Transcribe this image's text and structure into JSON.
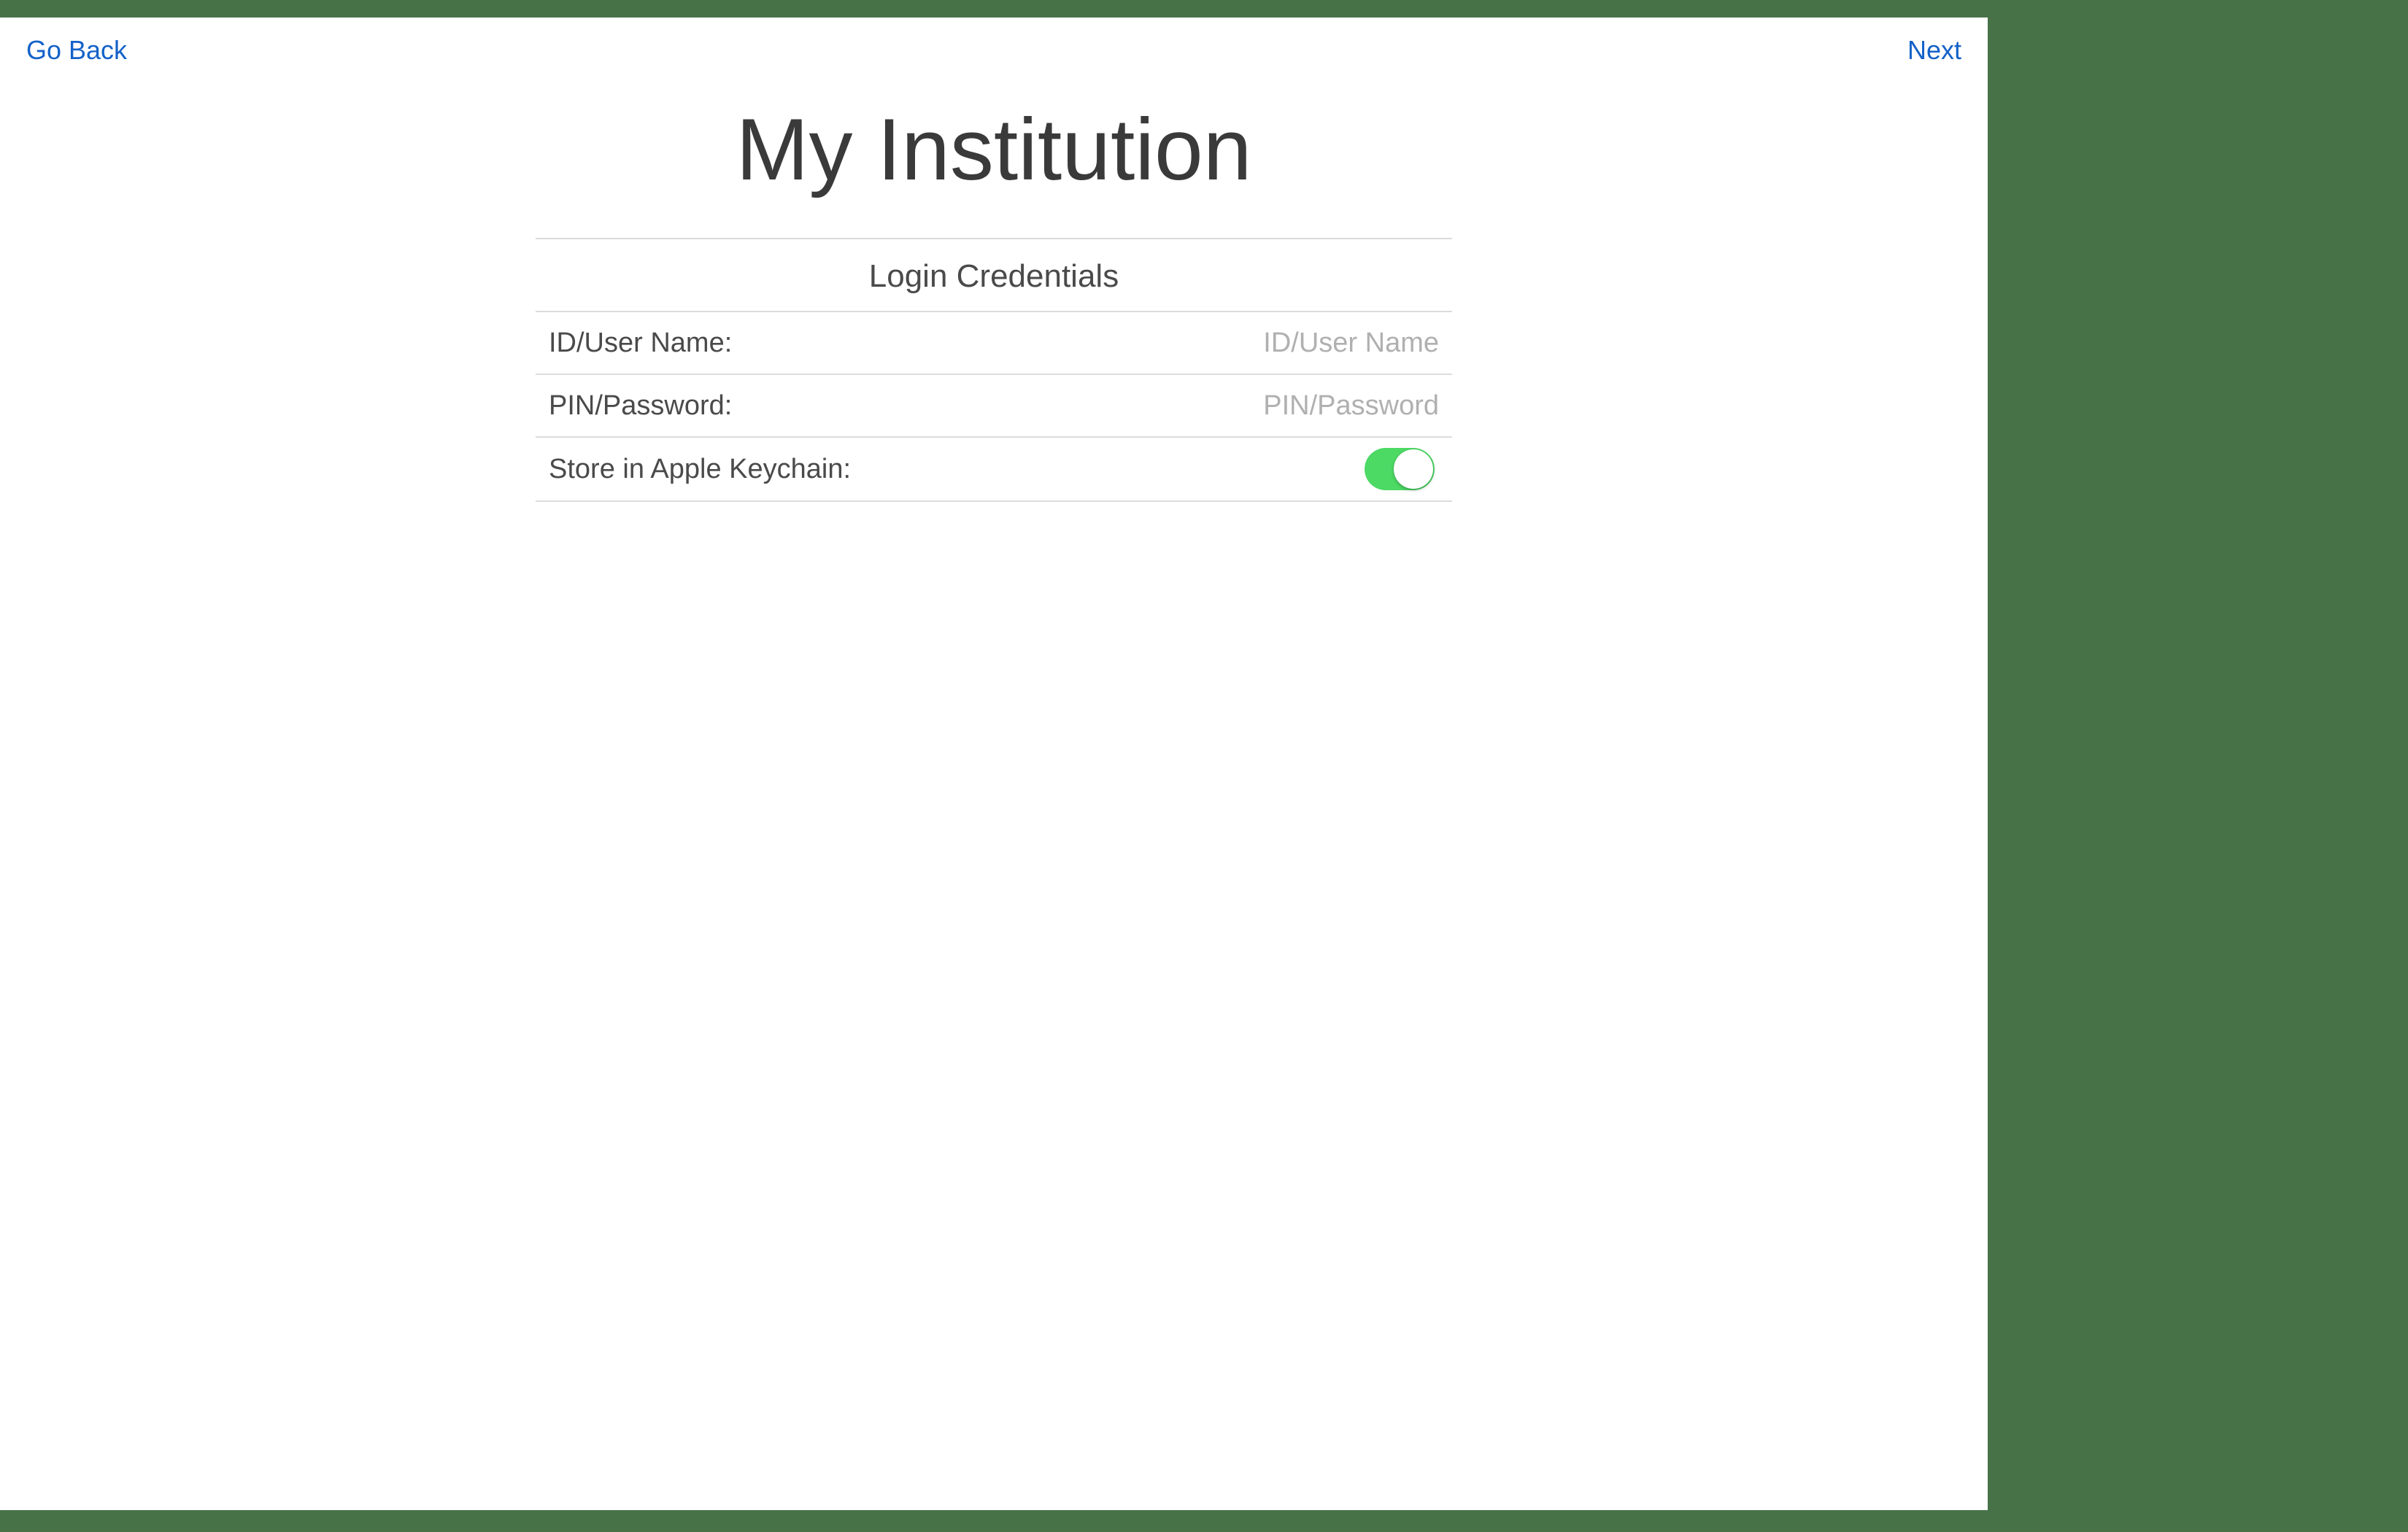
{
  "nav": {
    "back_label": "Go Back",
    "next_label": "Next"
  },
  "page": {
    "title": "My Institution"
  },
  "form": {
    "section_header": "Login Credentials",
    "rows": {
      "username": {
        "label": "ID/User Name:",
        "placeholder": "ID/User Name",
        "value": ""
      },
      "password": {
        "label": "PIN/Password:",
        "placeholder": "PIN/Password",
        "value": ""
      },
      "keychain": {
        "label": "Store in Apple Keychain:",
        "enabled": true
      }
    }
  },
  "colors": {
    "background": "#477248",
    "link": "#1462c8",
    "toggle_on": "#4cd964"
  }
}
